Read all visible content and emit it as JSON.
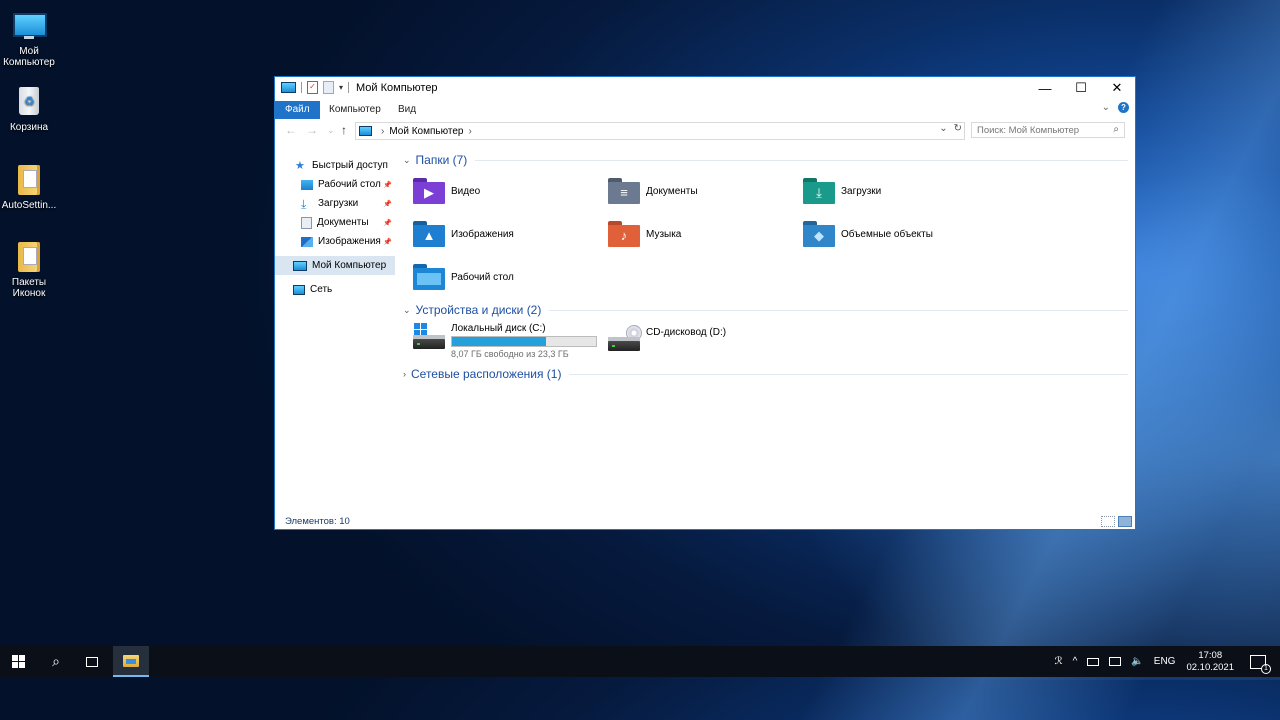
{
  "desktop": {
    "icons": [
      {
        "label": "Мой\nКомпьютер",
        "icon": "computer-icon"
      },
      {
        "label": "Корзина",
        "icon": "recycle-bin-icon"
      },
      {
        "label": "AutoSettin...",
        "icon": "folder-icon"
      },
      {
        "label": "Пакеты\nИконок",
        "icon": "folder-icon"
      }
    ]
  },
  "window": {
    "title": "Мой Компьютер",
    "controls": {
      "minimize": "—",
      "maximize": "☐",
      "close": "✕"
    },
    "ribbon_tabs": [
      {
        "label": "Файл",
        "active": true
      },
      {
        "label": "Компьютер",
        "active": false
      },
      {
        "label": "Вид",
        "active": false
      }
    ],
    "address": {
      "back": "←",
      "forward": "→",
      "recent": "⌄",
      "up": "↑",
      "crumb_sep": "›",
      "location": "Мой Компьютер",
      "crumb_end": "›",
      "dropdown": "⌄",
      "refresh": "↻",
      "search_placeholder": "Поиск: Мой Компьютер",
      "search_glyph": "⌕"
    },
    "nav_pane": {
      "items": [
        {
          "label": "Быстрый доступ",
          "icon": "star-icon",
          "pinned": false
        },
        {
          "label": "Рабочий стол",
          "icon": "desktop-icon",
          "pinned": true
        },
        {
          "label": "Загрузки",
          "icon": "download-icon",
          "pinned": true
        },
        {
          "label": "Документы",
          "icon": "documents-icon",
          "pinned": true
        },
        {
          "label": "Изображения",
          "icon": "pictures-icon",
          "pinned": true
        },
        {
          "label": "Мой Компьютер",
          "icon": "computer-icon",
          "pinned": false,
          "selected": true
        },
        {
          "label": "Сеть",
          "icon": "network-icon",
          "pinned": false
        }
      ],
      "pin_glyph": "📌"
    },
    "groups": {
      "folders": {
        "title": "Папки (7)",
        "items": [
          {
            "label": "Видео",
            "color": "#7b3fd6",
            "glyph": "▶"
          },
          {
            "label": "Документы",
            "color": "#6b7a90",
            "glyph": "≡"
          },
          {
            "label": "Загрузки",
            "color": "#1a9a8a",
            "glyph": "⤓"
          },
          {
            "label": "Изображения",
            "color": "#1e7fd0",
            "glyph": "▲"
          },
          {
            "label": "Музыка",
            "color": "#e0603a",
            "glyph": "♪"
          },
          {
            "label": "Объемные объекты",
            "color": "#2f86c9",
            "glyph": "◆"
          },
          {
            "label": "Рабочий стол",
            "color": "#1d86d6",
            "glyph": ""
          }
        ]
      },
      "devices": {
        "title": "Устройства и диски (2)",
        "items": [
          {
            "label": "Локальный диск (C:)",
            "sub": "8,07 ГБ свободно из 23,3 ГБ",
            "used_fraction": 0.654
          },
          {
            "label": "CD-дисковод (D:)"
          }
        ]
      },
      "network": {
        "title": "Сетевые расположения (1)"
      }
    },
    "status": {
      "count_text": "Элементов: 10"
    }
  },
  "taskbar": {
    "start": "start-icon",
    "search": "search-icon",
    "taskview": "task-view-icon",
    "explorer": "file-explorer-icon",
    "tray": {
      "people": "ℛ",
      "chevron": "^",
      "lang": "ENG",
      "time": "17:08",
      "date": "02.10.2021",
      "notifications_count": "1"
    }
  }
}
